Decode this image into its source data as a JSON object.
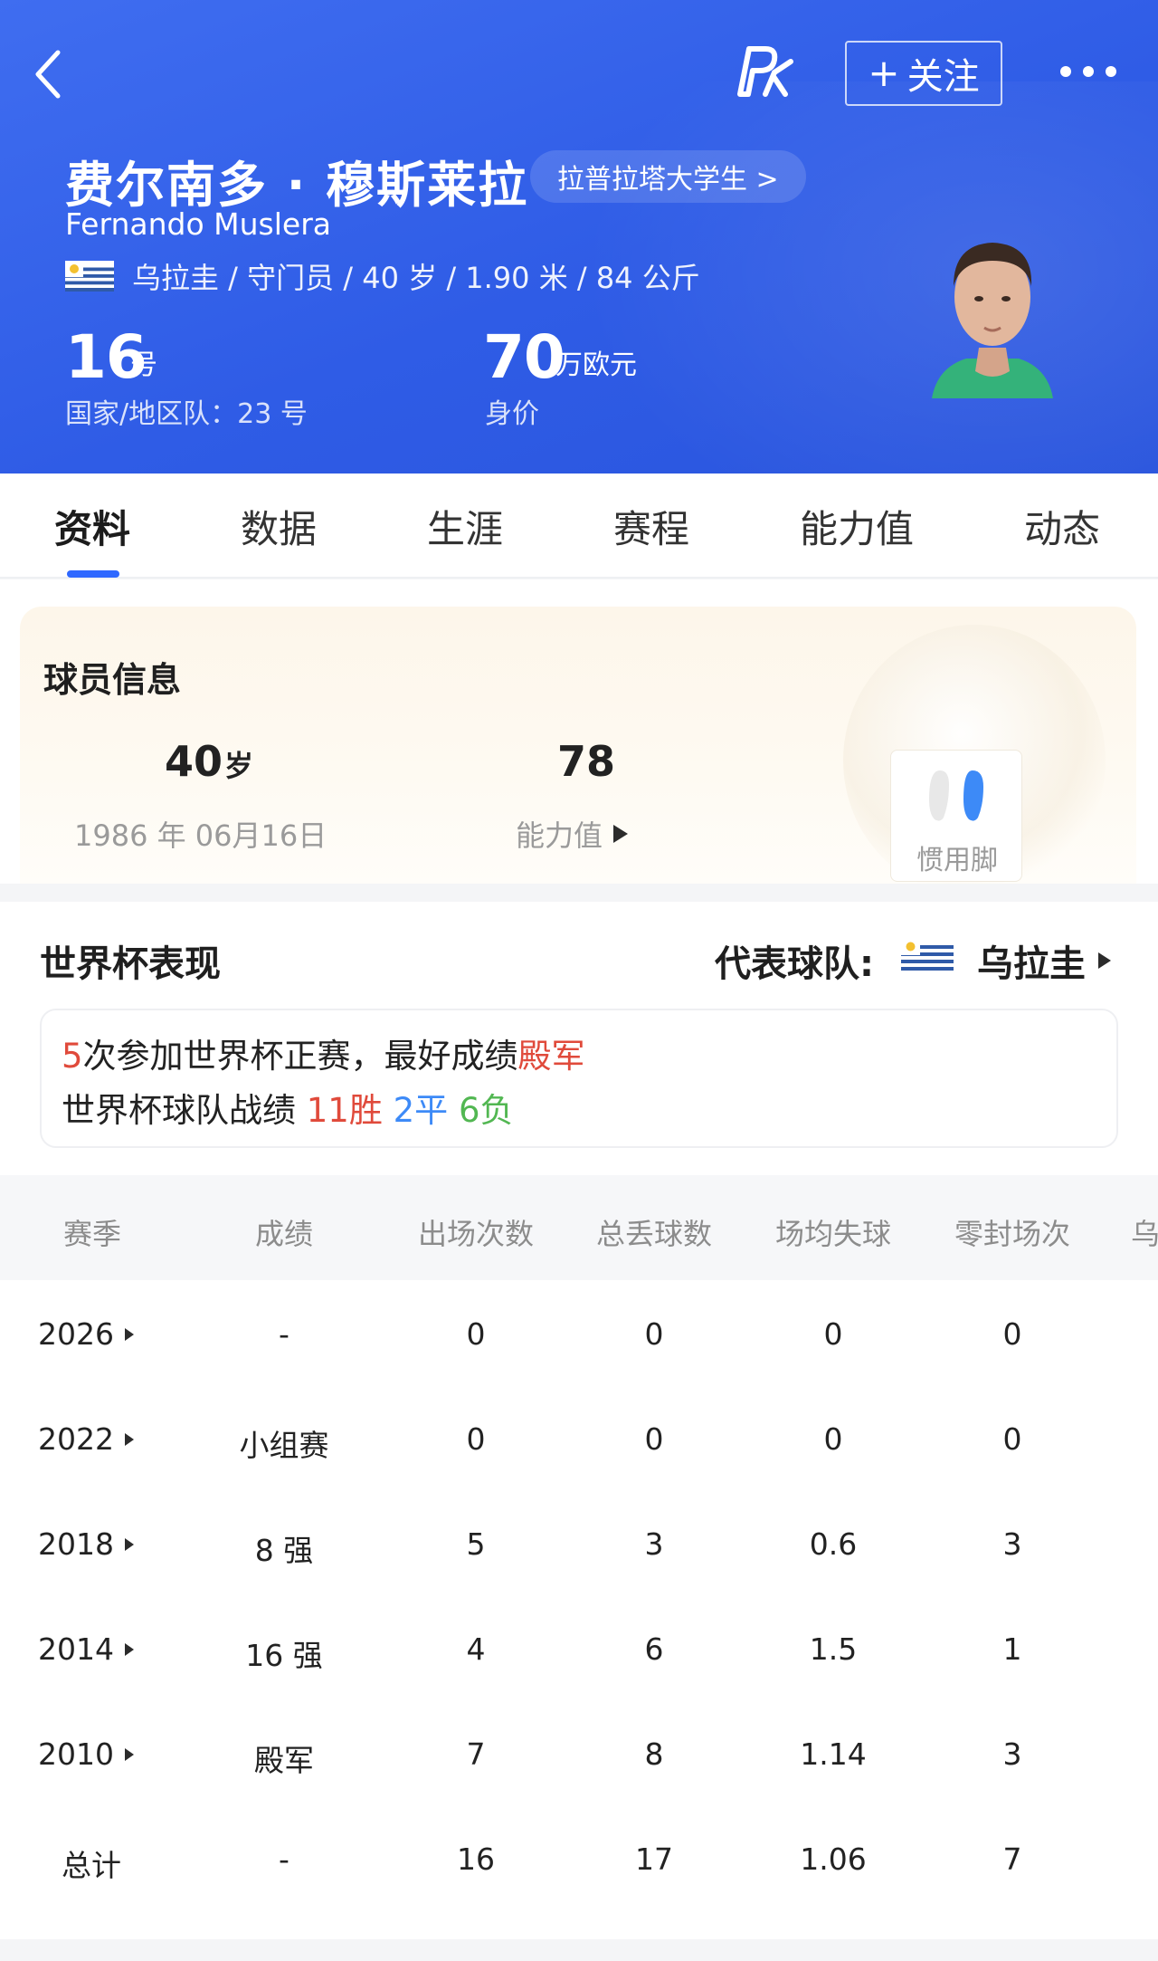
{
  "header": {
    "follow_label": "关注",
    "name_cn": "费尔南多 · 穆斯莱拉",
    "nickname": "拉普拉塔大学生 >",
    "name_en": "Fernando Muslera",
    "meta": "乌拉圭 / 守门员 / 40 岁 / 1.90 米 / 84 公斤",
    "number": "16",
    "number_unit": "号",
    "national_number": "国家/地区队：23 号",
    "value": "70",
    "value_unit": "万欧元",
    "value_label": "身价"
  },
  "tabs": [
    "资料",
    "数据",
    "生涯",
    "赛程",
    "能力值",
    "动态"
  ],
  "player_info": {
    "title": "球员信息",
    "age": "40",
    "age_unit": "岁",
    "birthdate": "1986 年 06月16日",
    "ability": "78",
    "ability_label": "能力值",
    "foot_label": "惯用脚"
  },
  "world_cup": {
    "title": "世界杯表现",
    "rep_label": "代表球队:",
    "rep_team": "乌拉圭",
    "summary1": {
      "count": "5",
      "text": "次参加世界杯正赛，最好成绩",
      "best": "殿军"
    },
    "summary2": {
      "prefix": "世界杯球队战绩 ",
      "wins": "11胜",
      "draws": "2平",
      "losses": "6负"
    },
    "columns": [
      "赛季",
      "成绩",
      "出场次数",
      "总丢球数",
      "场均失球",
      "零封场次",
      "乌"
    ],
    "rows": [
      {
        "season": "2026",
        "result": "-",
        "apps": "0",
        "conceded": "0",
        "avg": "0",
        "clean": "0"
      },
      {
        "season": "2022",
        "result": "小组赛",
        "apps": "0",
        "conceded": "0",
        "avg": "0",
        "clean": "0"
      },
      {
        "season": "2018",
        "result": "8 强",
        "apps": "5",
        "conceded": "3",
        "avg": "0.6",
        "clean": "3"
      },
      {
        "season": "2014",
        "result": "16 强",
        "apps": "4",
        "conceded": "6",
        "avg": "1.5",
        "clean": "1"
      },
      {
        "season": "2010",
        "result": "殿军",
        "apps": "7",
        "conceded": "8",
        "avg": "1.14",
        "clean": "3"
      }
    ],
    "total": {
      "label": "总计",
      "result": "-",
      "apps": "16",
      "conceded": "17",
      "avg": "1.06",
      "clean": "7"
    }
  },
  "colors": {
    "header_blue": "#2f5ce6",
    "accent": "#2f68ff",
    "red": "#e04a3b",
    "blue": "#3d8af7",
    "green": "#52b752"
  }
}
